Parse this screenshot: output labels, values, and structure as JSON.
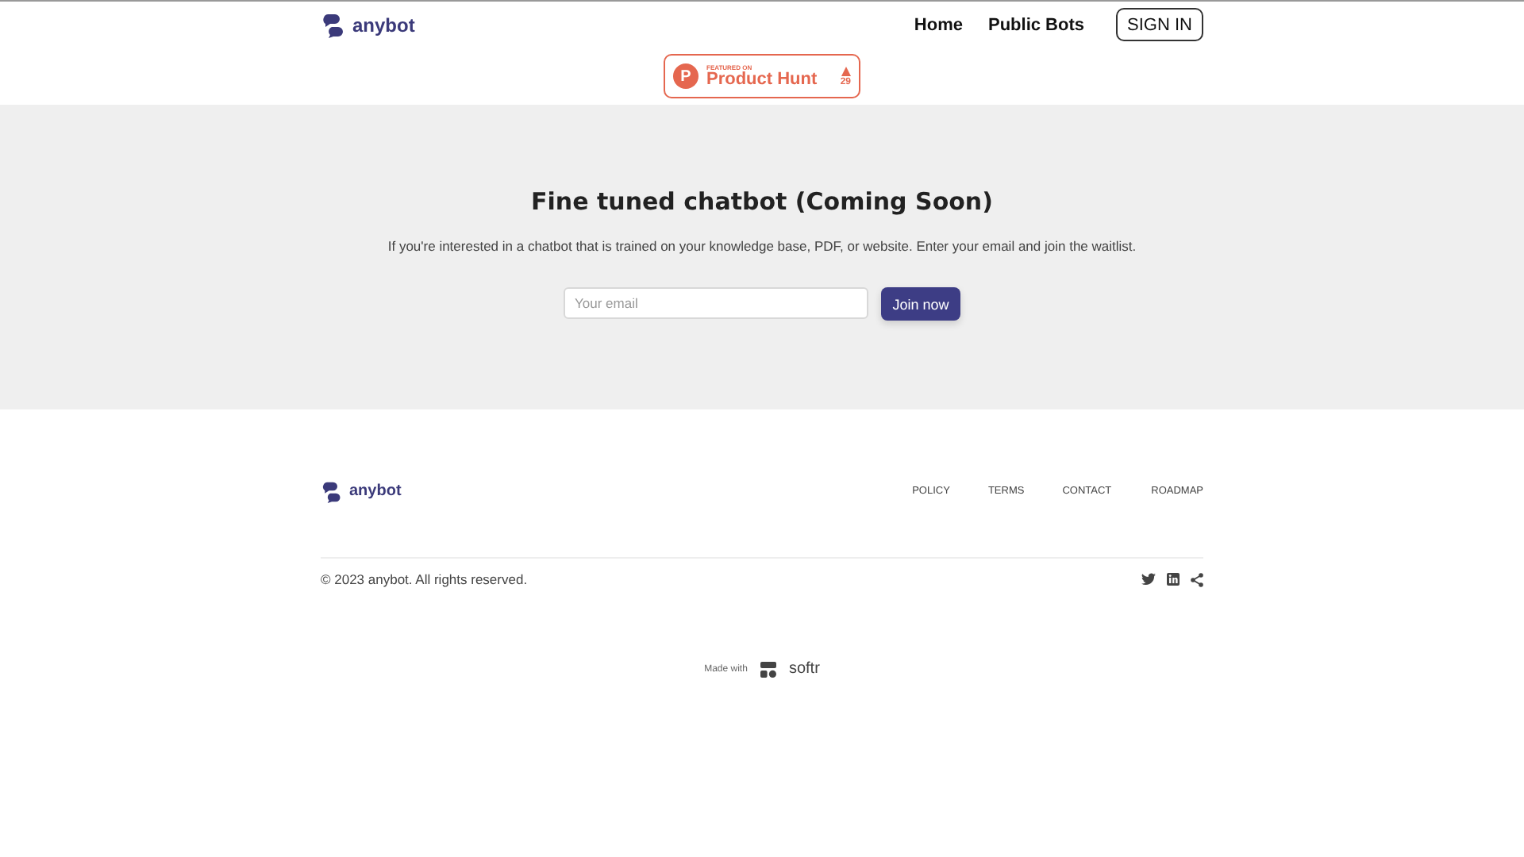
{
  "header": {
    "logo": "anybot",
    "nav": [
      "Home",
      "Public Bots"
    ],
    "sign_in": "SIGN IN"
  },
  "badge": {
    "featured": "FEATURED ON",
    "name": "Product Hunt",
    "votes": "29",
    "letter": "P"
  },
  "hero": {
    "title": "Fine tuned chatbot (Coming Soon)",
    "text": "If you're interested in a chatbot that is trained on your knowledge base, PDF, or website. Enter your email and join the waitlist.",
    "email": {
      "placeholder": "Your email"
    },
    "button": "Join now"
  },
  "footer": {
    "logo": "anybot",
    "links": [
      "POLICY",
      "TERMS",
      "CONTACT",
      "ROADMAP"
    ],
    "copyright": "© 2023 anybot. All rights reserved."
  },
  "made_with": {
    "label": "Made with",
    "brand": "softr"
  }
}
